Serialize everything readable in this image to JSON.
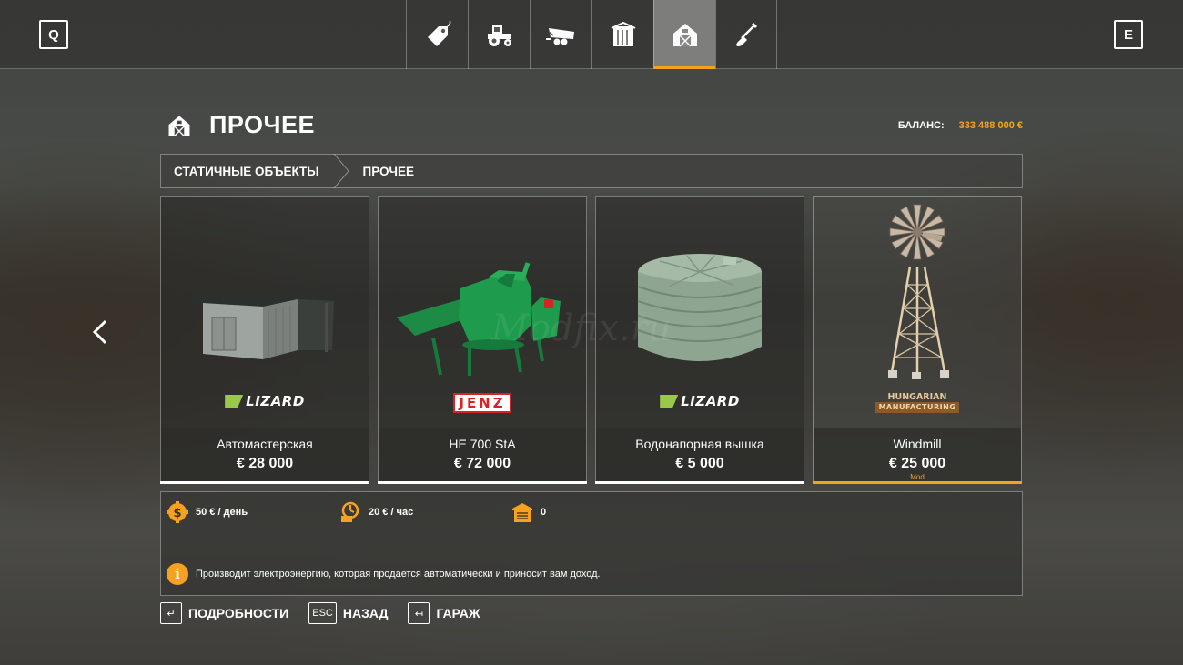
{
  "topbar": {
    "prev_key": "Q",
    "next_key": "E",
    "tabs": [
      {
        "icon": "price-tag-icon",
        "active": false
      },
      {
        "icon": "tractor-icon",
        "active": false
      },
      {
        "icon": "trailer-icon",
        "active": false
      },
      {
        "icon": "placeable-building-icon",
        "active": false
      },
      {
        "icon": "barn-icon",
        "active": true
      },
      {
        "icon": "shovel-icon",
        "active": false
      }
    ]
  },
  "header": {
    "title": "ПРОЧЕЕ",
    "icon": "barn-icon",
    "balance_label": "БАЛАНС:",
    "balance_value": "333 488 000 €"
  },
  "breadcrumb": {
    "items": [
      "СТАТИЧНЫЕ ОБЪЕКТЫ",
      "ПРОЧЕЕ"
    ]
  },
  "items": [
    {
      "name": "Автомастерская",
      "price": "€ 28 000",
      "brand": "LIZARD",
      "tag": ""
    },
    {
      "name": "HE 700 StA",
      "price": "€ 72 000",
      "brand": "JENZ",
      "tag": ""
    },
    {
      "name": "Водонапорная вышка",
      "price": "€ 5 000",
      "brand": "LIZARD",
      "tag": ""
    },
    {
      "name": "Windmill",
      "price": "€ 25 000",
      "brand_line1": "HUNGARIAN",
      "brand_line2": "MANUFACTURING",
      "tag": "Mod",
      "selected": true
    }
  ],
  "details": {
    "upkeep": "50 € / день",
    "income": "20 € / час",
    "capacity": "0",
    "description": "Производит электроэнергию, которая продается автоматически и приносит вам доход."
  },
  "watermark": "Modfix.ru",
  "actions": [
    {
      "key": "↵",
      "label": "ПОДРОБНОСТИ"
    },
    {
      "key": "ESC",
      "label": "НАЗАД"
    },
    {
      "key": "↤",
      "label": "ГАРАЖ"
    }
  ],
  "colors": {
    "accent": "#f6a21e",
    "jenz_red": "#d4242a",
    "lizard_green": "#9ac94a"
  }
}
